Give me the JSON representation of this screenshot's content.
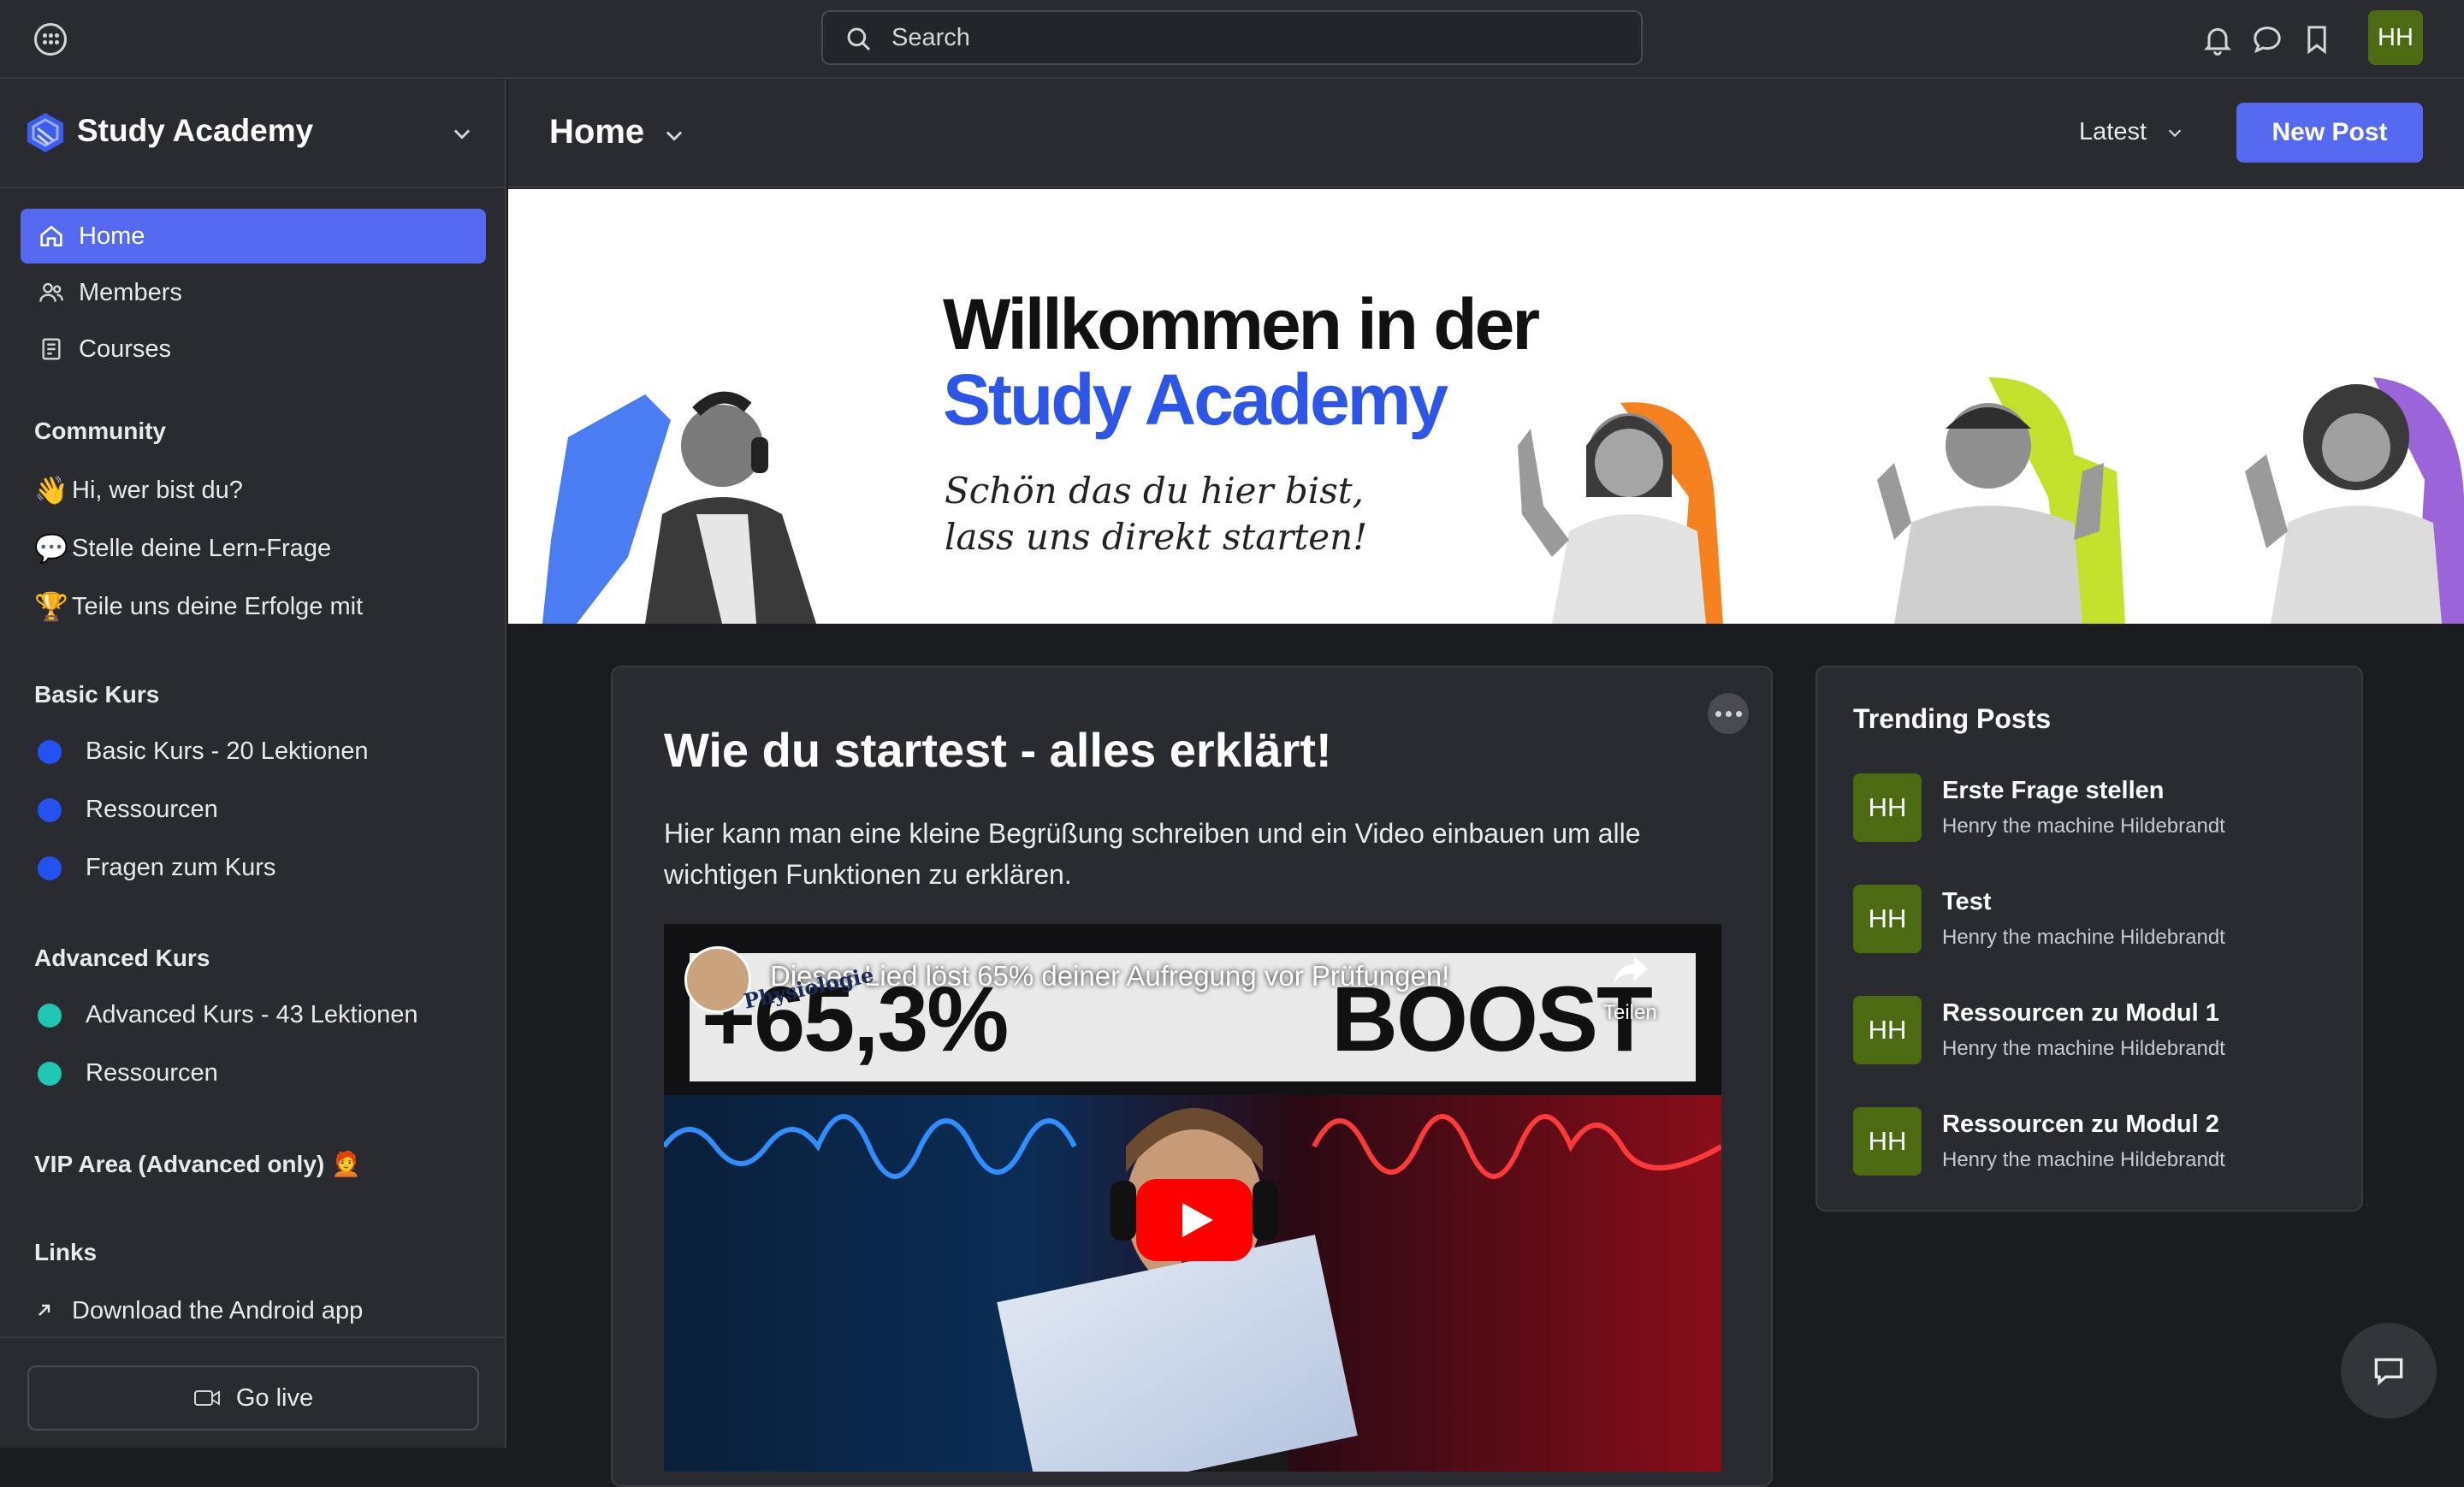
{
  "topbar": {
    "search_placeholder": "Search",
    "avatar_initials": "HH"
  },
  "sidebar": {
    "brand": "Study Academy",
    "nav": [
      {
        "label": "Home",
        "icon": "home-icon",
        "active": true
      },
      {
        "label": "Members",
        "icon": "members-icon"
      },
      {
        "label": "Courses",
        "icon": "courses-icon"
      }
    ],
    "sections": [
      {
        "title": "Community",
        "items": [
          {
            "emoji": "👋",
            "label": "Hi, wer bist du?"
          },
          {
            "emoji": "💬",
            "label": "Stelle deine Lern-Frage"
          },
          {
            "emoji": "🏆",
            "label": "Teile uns deine Erfolge mit"
          }
        ]
      },
      {
        "title": "Basic Kurs",
        "items": [
          {
            "dot_color": "#2452f0",
            "label": "Basic Kurs - 20 Lektionen"
          },
          {
            "dot_color": "#2452f0",
            "label": "Ressourcen"
          },
          {
            "dot_color": "#2452f0",
            "label": "Fragen zum Kurs"
          }
        ]
      },
      {
        "title": "Advanced Kurs",
        "items": [
          {
            "dot_color": "#1fc7b4",
            "label": "Advanced Kurs - 43 Lektionen"
          },
          {
            "dot_color": "#1fc7b4",
            "label": "Ressourcen"
          }
        ]
      },
      {
        "title": "VIP Area (Advanced only) 🧑‍🦰",
        "items": []
      },
      {
        "title": "Links",
        "items": [
          {
            "icon": "arrow-up-right-icon",
            "label": "Download the Android app"
          }
        ]
      }
    ],
    "go_live": "Go live"
  },
  "header": {
    "title": "Home",
    "sort": "Latest",
    "new_post": "New Post"
  },
  "banner": {
    "line1": "Willkommen in der",
    "line2": "Study Academy",
    "sub1": "Schön das du hier bist,",
    "sub2": "lass uns direkt starten!"
  },
  "post": {
    "title": "Wie du startest - alles erklärt!",
    "body": "Hier kann man eine kleine Begrüßung schreiben und ein Video einbauen um alle wichtigen Funktionen zu erklären.",
    "video": {
      "title": "Dieses Lied löst 65% deiner Aufregung vor Prüfungen!",
      "share": "Teilen",
      "big_left": "+65,3%",
      "big_right": "BOOST",
      "book_title": "Physiologie"
    }
  },
  "trending": {
    "title": "Trending Posts",
    "posts": [
      {
        "initials": "HH",
        "title": "Erste Frage stellen",
        "author": "Henry the machine Hildebrandt"
      },
      {
        "initials": "HH",
        "title": "Test",
        "author": "Henry the machine Hildebrandt"
      },
      {
        "initials": "HH",
        "title": "Ressourcen zu Modul 1",
        "author": "Henry the machine Hildebrandt"
      },
      {
        "initials": "HH",
        "title": "Ressourcen zu Modul 2",
        "author": "Henry the machine Hildebrandt"
      }
    ]
  },
  "colors": {
    "accent": "#5468f0",
    "avatar_green": "#4c6a12",
    "basic_dot": "#2452f0",
    "advanced_dot": "#1fc7b4"
  }
}
